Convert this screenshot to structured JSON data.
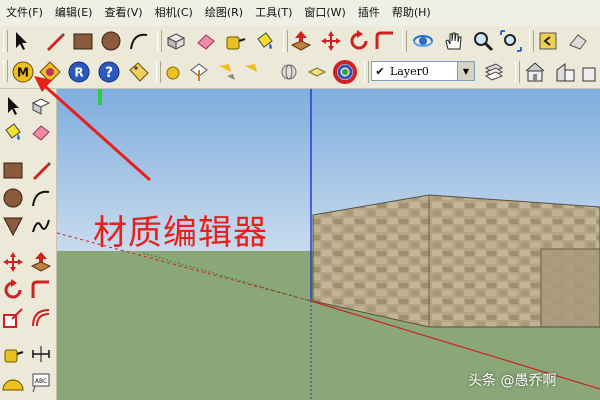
{
  "menu": [
    "文件(F)",
    "编辑(E)",
    "查看(V)",
    "相机(C)",
    "绘图(R)",
    "工具(T)",
    "窗口(W)",
    "插件",
    "帮助(H)"
  ],
  "layer": {
    "selected": "Layer0",
    "checked": "✔"
  },
  "annotation": {
    "text": "材质编辑器"
  },
  "watermark": {
    "text": "头条 @愚乔啊"
  },
  "colors": {
    "annotation": "#e8201c",
    "sky": "#8fb8e0",
    "ground": "#8aa877",
    "wall": "#b8aa8a"
  },
  "icons": {
    "toolbar1": [
      "select-arrow-icon",
      "pencil-line-icon",
      "rectangle-icon",
      "circle-icon",
      "arc-icon",
      "make-component-icon",
      "eraser-icon",
      "tape-measure-icon",
      "paint-bucket-icon",
      "push-pull-icon",
      "move-icon",
      "rotate-icon",
      "follow-me-icon",
      "orbit-icon",
      "pan-hand-icon",
      "zoom-icon",
      "zoom-extents-icon",
      "previous-view-icon",
      "next-view-icon"
    ],
    "toolbar2": [
      "material-editor-icon",
      "sandbox-icon",
      "ruby-icon",
      "help-icon",
      "tag-icon",
      "sphere-icon",
      "compass-icon",
      "shadow-icon",
      "globe-icon",
      "fog-icon",
      "color-wheel-icon",
      "layer-manager-icon",
      "house-front-icon",
      "house-side-icon"
    ]
  }
}
